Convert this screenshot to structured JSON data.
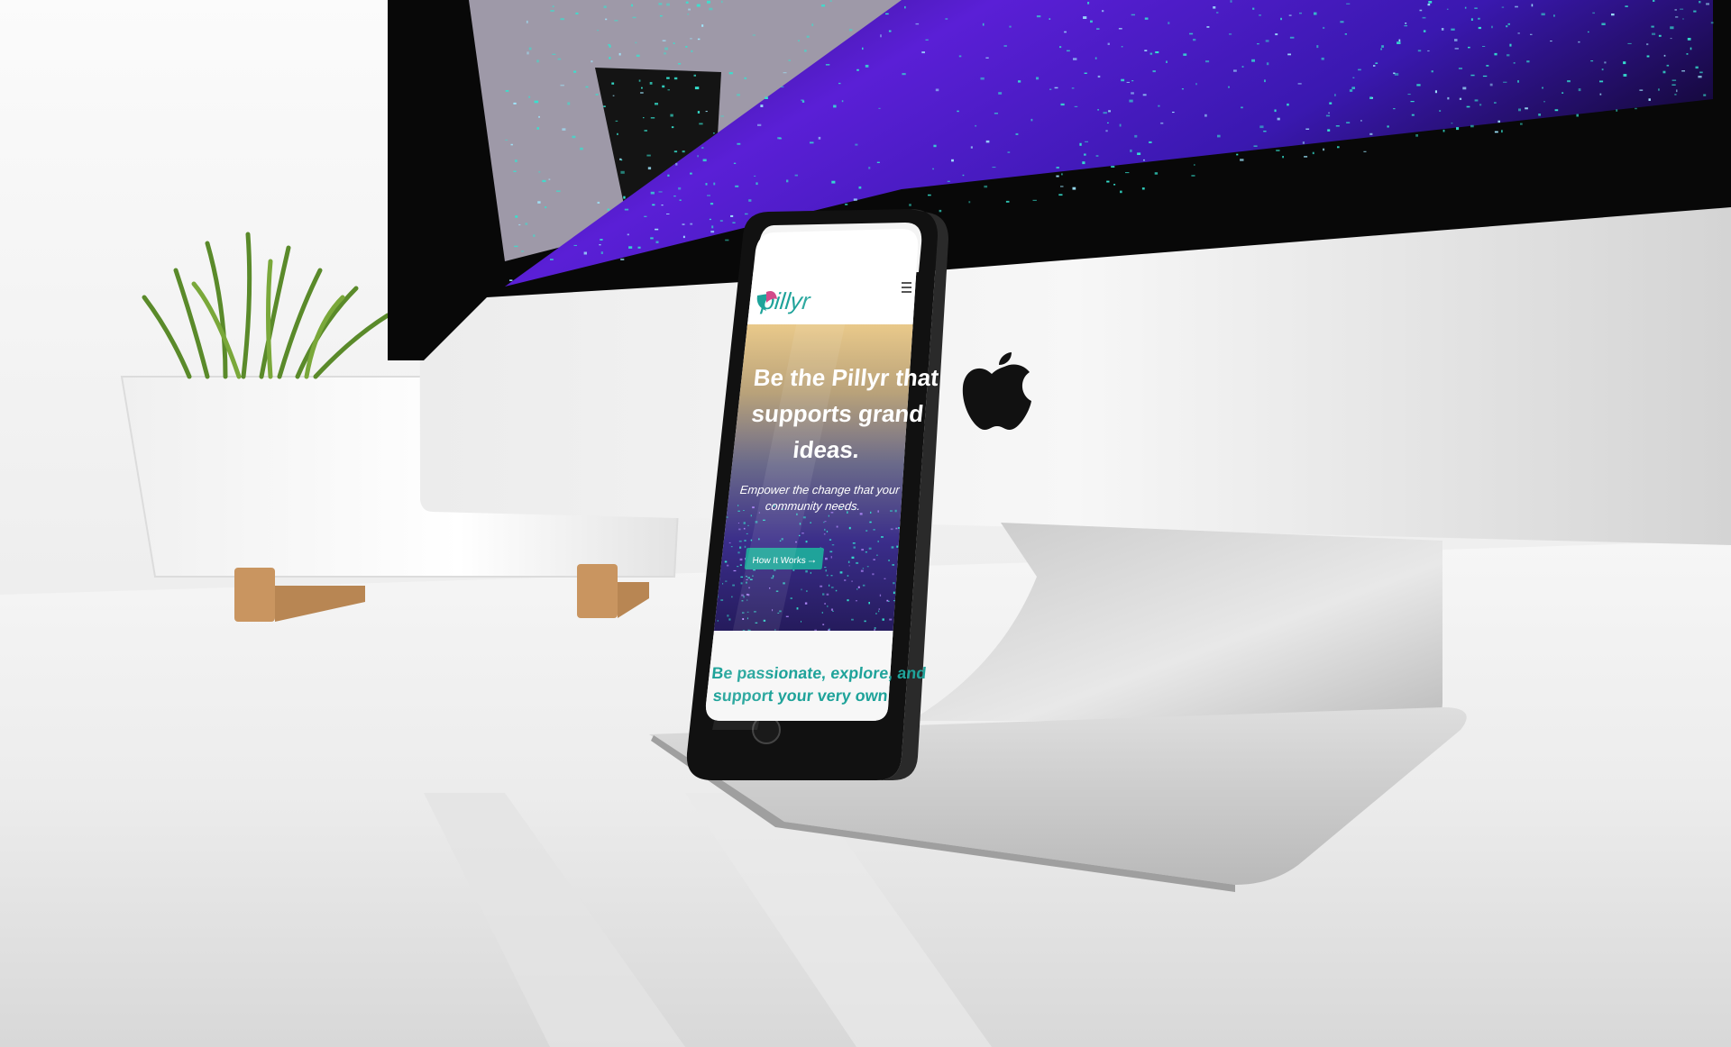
{
  "phone": {
    "logo_text": "pillyr",
    "menu_icon": "hamburger-menu-icon",
    "hero": {
      "headline_line1": "Be the Pillyr that",
      "headline_line2": "supports grand",
      "headline_line3": "ideas.",
      "subtext_line1": "Empower the change that your",
      "subtext_line2": "community needs.",
      "cta_label": "How It Works",
      "cta_icon": "arrow-right-icon"
    },
    "section": {
      "heading_line1": "Be passionate, explore, and",
      "heading_line2": "support your very own"
    }
  },
  "colors": {
    "accent_teal": "#1fa39a",
    "galaxy_purple": "#5a1fd6",
    "galaxy_cyan": "#35e3d0",
    "desk_white": "#f4f4f4",
    "aluminum": "#d9d9d9"
  },
  "decor": {
    "monitor_logo": "apple-logo-icon",
    "plant": "potted-grass-plant"
  }
}
